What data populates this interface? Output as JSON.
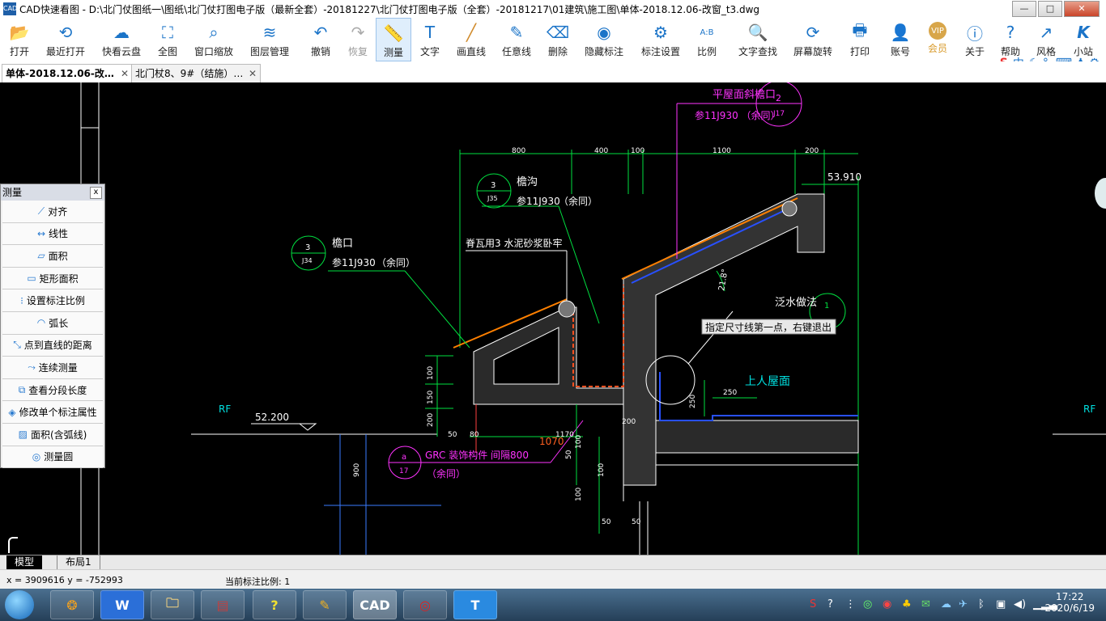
{
  "window": {
    "title": "CAD快速看图 - D:\\北门仗图纸一\\图纸\\北门仗打图电子版（最新全套）-20181227\\北门仗打图电子版（全套）-20181217\\01建筑\\施工图\\单体-2018.12.06-改窗_t3.dwg",
    "app_icon_text": "CAD",
    "minimize": "—",
    "maximize": "□",
    "close": "✕"
  },
  "toolbar": {
    "items": [
      {
        "label": "打开",
        "icon": "folder-icon",
        "glyph": "📂"
      },
      {
        "label": "最近打开",
        "icon": "history-icon",
        "glyph": "⟲"
      },
      {
        "label": "快看云盘",
        "icon": "cloud-icon",
        "glyph": "☁"
      },
      {
        "label": "全图",
        "icon": "fullview-icon",
        "glyph": "⛶"
      },
      {
        "label": "窗口缩放",
        "icon": "zoom-window-icon",
        "glyph": "⌕"
      },
      {
        "label": "图层管理",
        "icon": "layers-icon",
        "glyph": "≋"
      },
      {
        "label": "撤销",
        "icon": "undo-icon",
        "glyph": "↶"
      },
      {
        "label": "恢复",
        "icon": "redo-icon",
        "glyph": "↷"
      },
      {
        "label": "测量",
        "icon": "measure-icon",
        "glyph": "📏"
      },
      {
        "label": "文字",
        "icon": "text-icon",
        "glyph": "T"
      },
      {
        "label": "画直线",
        "icon": "line-icon",
        "glyph": "╱"
      },
      {
        "label": "任意线",
        "icon": "pen-icon",
        "glyph": "✎"
      },
      {
        "label": "删除",
        "icon": "eraser-icon",
        "glyph": "⌫"
      },
      {
        "label": "隐藏标注",
        "icon": "eye-hide-icon",
        "glyph": "◉"
      },
      {
        "label": "标注设置",
        "icon": "settings-icon",
        "glyph": "⚙"
      },
      {
        "label": "比例",
        "icon": "scale-icon",
        "glyph": "A:B"
      },
      {
        "label": "文字查找",
        "icon": "text-search-icon",
        "glyph": "🔍"
      },
      {
        "label": "屏幕旋转",
        "icon": "rotate-icon",
        "glyph": "⟳"
      },
      {
        "label": "打印",
        "icon": "print-icon",
        "glyph": "🖶"
      },
      {
        "label": "账号",
        "icon": "account-icon",
        "glyph": "👤"
      },
      {
        "label": "会员",
        "icon": "vip-icon",
        "glyph": "VIP"
      },
      {
        "label": "关于",
        "icon": "info-icon",
        "glyph": "ⓘ"
      },
      {
        "label": "帮助",
        "icon": "help-icon",
        "glyph": "?"
      },
      {
        "label": "风格",
        "icon": "style-icon",
        "glyph": "↗"
      },
      {
        "label": "小站",
        "icon": "site-icon",
        "glyph": "K"
      }
    ]
  },
  "tabs": [
    {
      "label": "单体-2018.12.06-改…",
      "close": "✕"
    },
    {
      "label": "北门杖8、9#（结施）…",
      "close": "✕"
    }
  ],
  "ime": {
    "label": "中",
    "glyphs": "☾ °, ⌨ ♟ ⚙"
  },
  "measure_panel": {
    "title": "测量",
    "close": "x",
    "items": [
      {
        "label": "对齐",
        "icon": "align-measure-icon"
      },
      {
        "label": "线性",
        "icon": "linear-measure-icon"
      },
      {
        "label": "面积",
        "icon": "area-icon"
      },
      {
        "label": "矩形面积",
        "icon": "rect-area-icon"
      },
      {
        "label": "设置标注比例",
        "icon": "dim-scale-icon"
      },
      {
        "label": "弧长",
        "icon": "arc-length-icon"
      },
      {
        "label": "点到直线的距离",
        "icon": "point-line-distance-icon"
      },
      {
        "label": "连续测量",
        "icon": "continuous-measure-icon"
      },
      {
        "label": "查看分段长度",
        "icon": "segment-length-icon"
      },
      {
        "label": "修改单个标注属性",
        "icon": "edit-dim-icon"
      },
      {
        "label": "面积(含弧线)",
        "icon": "arc-area-icon"
      },
      {
        "label": "测量圆",
        "icon": "measure-circle-icon"
      }
    ]
  },
  "drawing": {
    "texts": {
      "flat_roof": "平屋面斜檐口",
      "ref_11j930": "参11J930 （余同）",
      "ref_short": "参11J930",
      "ref_tail": "（余同）",
      "gutter": "檐沟",
      "eave": "檐口",
      "tile": "脊瓦用3 水泥砂浆卧牢",
      "flashing": "泛水做法",
      "roof_walk": "上人屋面",
      "grc": "GRC 装饰构件 间隔800",
      "rf": "RF",
      "elev_1": "53.910",
      "elev_2": "52.200",
      "tooltip": "指定尺寸线第一点，右键退出",
      "angle": "21.8°",
      "tag_2": "2",
      "tag_j17": "J17",
      "tag_3": "3",
      "tag_j35": "J35",
      "tag_j34": "J34",
      "tag_a": "a",
      "tag_17": "17",
      "tag_1": "1"
    },
    "dims_top": [
      "800",
      "400",
      "100",
      "1100",
      "200"
    ],
    "dims_misc": [
      "1070",
      "1170",
      "250",
      "250",
      "200",
      "50",
      "80",
      "100",
      "150",
      "200",
      "100",
      "100",
      "50",
      "100",
      "50",
      "50",
      "900"
    ]
  },
  "layout_tabs": [
    {
      "label": "模型"
    },
    {
      "label": "布局1"
    }
  ],
  "status": {
    "coords": "x = 3909616 y = -752993",
    "scale": "当前标注比例: 1"
  },
  "taskbar": {
    "apps": [
      "❂",
      "W",
      "🗀",
      "▤",
      "?",
      "✎",
      "CAD",
      "◎",
      "T"
    ],
    "time": "17:22",
    "date": "2020/6/19"
  }
}
